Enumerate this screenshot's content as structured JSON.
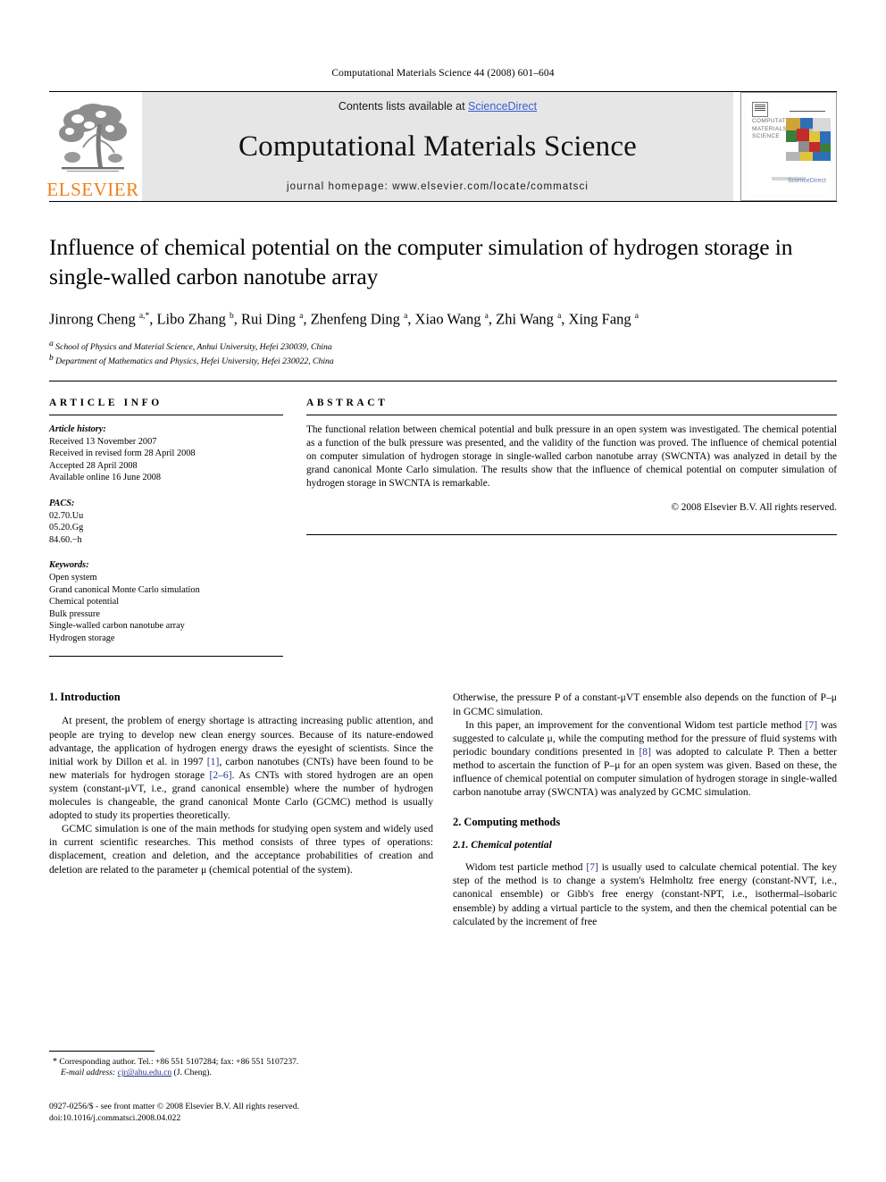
{
  "running_head": "Computational Materials Science 44 (2008) 601–604",
  "banner": {
    "publisher_name": "ELSEVIER",
    "contents_prefix": "Contents lists available at ",
    "contents_link": "ScienceDirect",
    "journal_title": "Computational Materials Science",
    "homepage": "journal homepage: www.elsevier.com/locate/commatsci",
    "cover": {
      "title_lines": [
        "COMPUTATIONAL",
        "MATERIALS",
        "SCIENCE"
      ],
      "brand": "ScienceDirect"
    },
    "link_color": "#3a5fd0",
    "publisher_color": "#F07F1A"
  },
  "article": {
    "title": "Influence of chemical potential on the computer simulation of hydrogen storage in single-walled carbon nanotube array",
    "authors": "Jinrong Cheng a,*, Libo Zhang b, Rui Ding a, Zhenfeng Ding a, Xiao Wang a, Zhi Wang a, Xing Fang a",
    "affiliations": [
      "a School of Physics and Material Science, Anhui University, Hefei 230039, China",
      "b Department of Mathematics and Physics, Hefei University, Hefei 230022, China"
    ]
  },
  "info": {
    "heading": "ARTICLE INFO",
    "history_label": "Article history:",
    "history": [
      "Received 13 November 2007",
      "Received in revised form 28 April 2008",
      "Accepted 28 April 2008",
      "Available online 16 June 2008"
    ],
    "pacs_label": "PACS:",
    "pacs": [
      "02.70.Uu",
      "05.20.Gg",
      "84.60.−h"
    ],
    "keywords_label": "Keywords:",
    "keywords": [
      "Open system",
      "Grand canonical Monte Carlo simulation",
      "Chemical potential",
      "Bulk pressure",
      "Single-walled carbon nanotube array",
      "Hydrogen storage"
    ]
  },
  "abstract": {
    "heading": "ABSTRACT",
    "text": "The functional relation between chemical potential and bulk pressure in an open system was investigated. The chemical potential as a function of the bulk pressure was presented, and the validity of the function was proved. The influence of chemical potential on computer simulation of hydrogen storage in single-walled carbon nanotube array (SWCNTA) was analyzed in detail by the grand canonical Monte Carlo simulation. The results show that the influence of chemical potential on computer simulation of hydrogen storage in SWCNTA is remarkable.",
    "copyright": "© 2008 Elsevier B.V. All rights reserved."
  },
  "body": {
    "left": {
      "section1_heading": "1. Introduction",
      "p1_a": "At present, the problem of energy shortage is attracting increasing public attention, and people are trying to develop new clean energy sources. Because of its nature-endowed advantage, the application of hydrogen energy draws the eyesight of scientists. Since the initial work by Dillon et al. in 1997 ",
      "p1_ref1": "[1]",
      "p1_b": ", carbon nanotubes (CNTs) have been found to be new materials for hydrogen storage ",
      "p1_ref2": "[2–6]",
      "p1_c": ". As CNTs with stored hydrogen are an open system (constant-μVT, i.e., grand canonical ensemble) where the number of hydrogen molecules is changeable, the grand canonical Monte Carlo (GCMC) method is usually adopted to study its properties theoretically.",
      "p2": "GCMC simulation is one of the main methods for studying open system and widely used in current scientific researches. This method consists of three types of operations: displacement, creation and deletion, and the acceptance probabilities of creation and deletion are related to the parameter μ (chemical potential of the system)."
    },
    "right": {
      "p1": "Otherwise, the pressure P of a constant-μVT ensemble also depends on the function of P–μ in GCMC simulation.",
      "p2_a": "In this paper, an improvement for the conventional Widom test particle method ",
      "p2_ref1": "[7]",
      "p2_b": " was suggested to calculate μ, while the computing method for the pressure of fluid systems with periodic boundary conditions presented in ",
      "p2_ref2": "[8]",
      "p2_c": " was adopted to calculate P. Then a better method to ascertain the function of P–μ for an open system was given. Based on these, the influence of chemical potential on computer simulation of hydrogen storage in single-walled carbon nanotube array (SWCNTA) was analyzed by GCMC simulation.",
      "section2_heading": "2. Computing methods",
      "section21_heading": "2.1. Chemical potential",
      "p3_a": "Widom test particle method ",
      "p3_ref1": "[7]",
      "p3_b": " is usually used to calculate chemical potential. The key step of the method is to change a system's Helmholtz free energy (constant-NVT, i.e., canonical ensemble) or Gibb's free energy (constant-NPT, i.e., isothermal–isobaric ensemble) by adding a virtual particle to the system, and then the chemical potential can be calculated by the increment of free"
    }
  },
  "footnote": {
    "marker": "*",
    "text_a": "Corresponding author. Tel.: +86 551 5107284; fax: +86 551 5107237.",
    "email_label": "E-mail address:",
    "email": "cjr@ahu.edu.cn",
    "email_owner": "(J. Cheng)."
  },
  "footer": {
    "line1": "0927-0256/$ - see front matter © 2008 Elsevier B.V. All rights reserved.",
    "line2": "doi:10.1016/j.commatsci.2008.04.022"
  }
}
